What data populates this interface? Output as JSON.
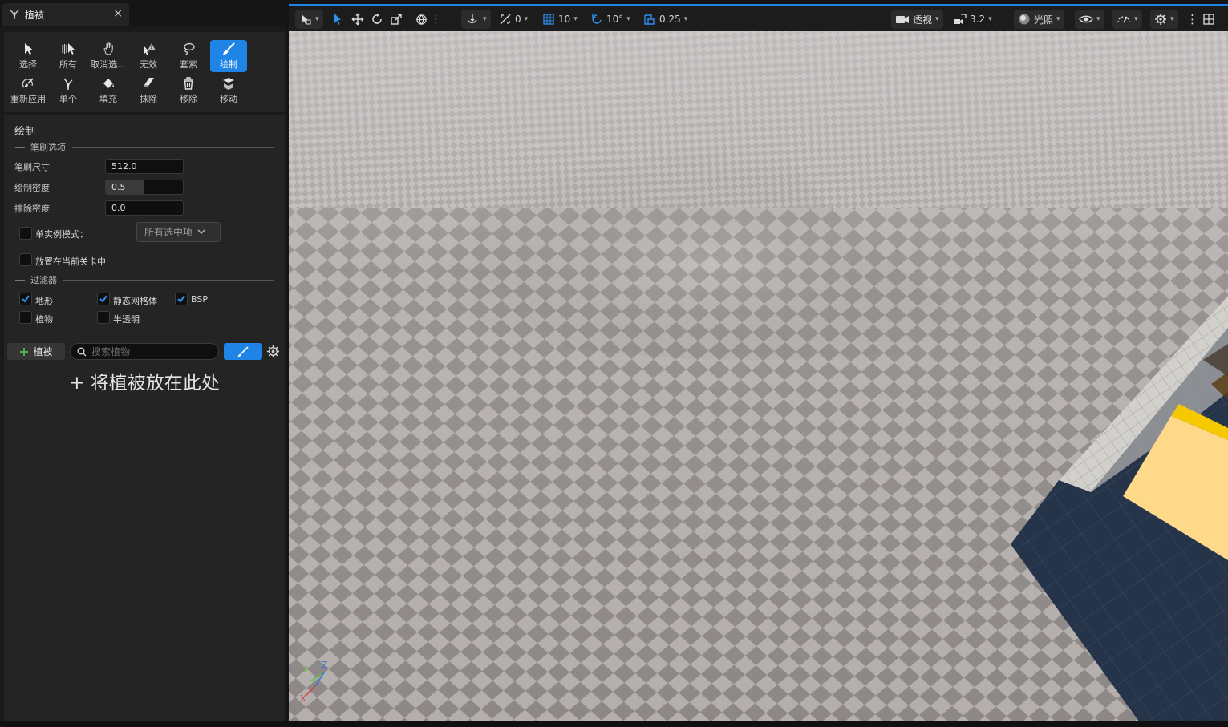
{
  "panel": {
    "tab_title": "植被",
    "tab_close": "×",
    "tools": [
      {
        "label": "选择",
        "icon": "arrow-cursor-icon"
      },
      {
        "label": "所有",
        "icon": "select-all-icon"
      },
      {
        "label": "取消选...",
        "icon": "deselect-hand-icon"
      },
      {
        "label": "无效",
        "icon": "invalid-warning-icon"
      },
      {
        "label": "套索",
        "icon": "lasso-icon"
      },
      {
        "label": "绘制",
        "icon": "paint-brush-icon",
        "active": true
      },
      {
        "label": "重新应用",
        "icon": "reapply-brush-icon"
      },
      {
        "label": "单个",
        "icon": "single-plant-icon"
      },
      {
        "label": "填充",
        "icon": "fill-bucket-icon"
      },
      {
        "label": "抹除",
        "icon": "eraser-icon"
      },
      {
        "label": "移除",
        "icon": "trash-icon"
      },
      {
        "label": "移动",
        "icon": "move-box-icon"
      }
    ],
    "section_title": "绘制",
    "brush_group": "笔刷选项",
    "brush_size_label": "笔刷尺寸",
    "brush_size_value": "512.0",
    "paint_density_label": "绘制密度",
    "paint_density_value": "0.5",
    "paint_density_fraction": 0.5,
    "erase_density_label": "擦除密度",
    "erase_density_value": "0.0",
    "single_instance_label": "单实例模式：",
    "single_instance_dropdown": "所有选中项",
    "place_in_level_label": "放置在当前关卡中",
    "filter_group": "过滤器",
    "filters": {
      "landscape": {
        "label": "地形",
        "checked": true
      },
      "static_mesh": {
        "label": "静态网格体",
        "checked": true
      },
      "bsp": {
        "label": "BSP",
        "checked": true
      },
      "foliage": {
        "label": "植物",
        "checked": false
      },
      "translucent": {
        "label": "半透明",
        "checked": false
      }
    },
    "add_foliage_label": "植被",
    "search_placeholder": "搜索植物",
    "drop_hint": "+ 将植被放在此处"
  },
  "viewport": {
    "toolbar": {
      "translate_snap": "0",
      "grid_snap": "10",
      "rotate_snap": "10°",
      "scale_snap": "0.25",
      "view_mode": "透视",
      "camera_speed": "3.2",
      "lighting": "光照"
    },
    "axis": {
      "x": "X",
      "y": "Y",
      "z": "Z"
    }
  },
  "colors": {
    "accent": "#1f84e6",
    "panel_bg": "#242424",
    "floor_light": "#b3aeac",
    "floor_dark": "#8a8584"
  }
}
